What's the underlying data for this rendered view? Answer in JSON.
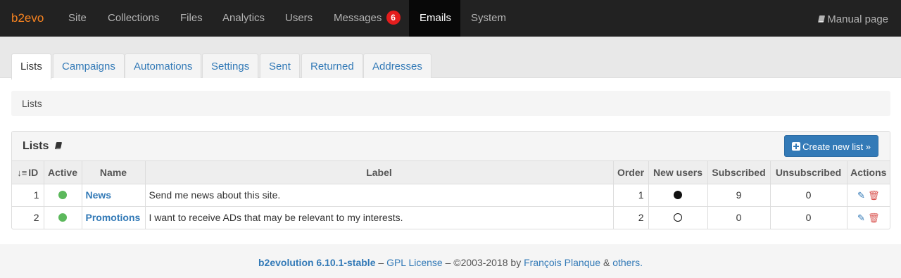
{
  "topbar": {
    "logo": "b2evo",
    "nav": [
      {
        "label": "Site"
      },
      {
        "label": "Collections"
      },
      {
        "label": "Files"
      },
      {
        "label": "Analytics"
      },
      {
        "label": "Users"
      },
      {
        "label": "Messages",
        "badge": "6"
      },
      {
        "label": "Emails",
        "active": true
      },
      {
        "label": "System"
      }
    ],
    "manual_label": "Manual page"
  },
  "tabs": [
    {
      "label": "Lists",
      "active": true
    },
    {
      "label": "Campaigns"
    },
    {
      "label": "Automations"
    },
    {
      "label": "Settings"
    },
    {
      "label": "Sent"
    },
    {
      "label": "Returned"
    },
    {
      "label": "Addresses"
    }
  ],
  "breadcrumb": "Lists",
  "panel": {
    "title": "Lists",
    "create_button": "Create new list »"
  },
  "table": {
    "columns": [
      "ID",
      "Active",
      "Name",
      "Label",
      "Order",
      "New users",
      "Subscribed",
      "Unsubscribed",
      "Actions"
    ],
    "rows": [
      {
        "id": "1",
        "active": true,
        "name": "News",
        "label": "Send me news about this site.",
        "order": "1",
        "new_users": true,
        "subscribed": "9",
        "unsubscribed": "0"
      },
      {
        "id": "2",
        "active": true,
        "name": "Promotions",
        "label": "I want to receive ADs that may be relevant to my interests.",
        "order": "2",
        "new_users": false,
        "subscribed": "0",
        "unsubscribed": "0"
      }
    ]
  },
  "footer": {
    "product": "b2evolution 6.10.1-stable",
    "sep1": " – ",
    "license": "GPL License",
    "copyright": " – ©2003-2018 by ",
    "author": "François Planque",
    "amp": " & ",
    "others": "others."
  },
  "colors": {
    "brand": "#f58220",
    "link": "#337ab7",
    "active_dot": "#5cb85c",
    "badge": "#e41d1d",
    "delete": "#d9534f"
  }
}
